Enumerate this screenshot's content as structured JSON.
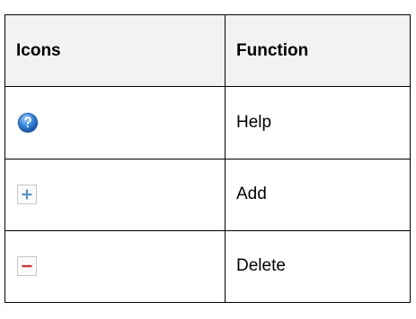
{
  "table": {
    "headers": {
      "icons": "Icons",
      "function": "Function"
    },
    "rows": [
      {
        "icon": "help-icon",
        "function": "Help"
      },
      {
        "icon": "add-icon",
        "function": "Add"
      },
      {
        "icon": "delete-icon",
        "function": "Delete"
      }
    ]
  },
  "colors": {
    "header_background": "#f2f2f2",
    "border": "#000000",
    "help_icon_blue": "#2f7fd6",
    "add_icon_blue": "#5a8fd0",
    "delete_icon_red": "#d13a3a"
  }
}
